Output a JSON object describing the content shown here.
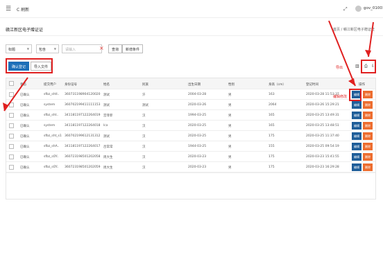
{
  "topbar": {
    "menu_icon": "menu-icon",
    "refresh_label": "C 刷新",
    "expand_icon": "expand-icon",
    "user_label": "gov_01001"
  },
  "page": {
    "title": "赣江新区电子赠证证",
    "breadcrumb": "首页 / 赣江新区电子赠证证"
  },
  "search": {
    "field_select": "标题",
    "op_select": "包含",
    "placeholder": "请输入",
    "query_label": "查询",
    "add_condition_label": "新增条件"
  },
  "actions": {
    "confirm_label": "确认登记",
    "import_label": "导入文件"
  },
  "hints": {
    "export_hint": "导出",
    "edit_hint": "编辑修改"
  },
  "table": {
    "columns": [
      "状态",
      "提交用户",
      "身份证号",
      "姓名",
      "民族",
      "出生日期",
      "性别",
      "身高（cm）",
      "登记时间",
      "操作"
    ],
    "edit_label": "编辑",
    "delete_label": "删除",
    "rows": [
      [
        "已确认",
        "sfbz_shtl..",
        "360731198904120020",
        "测试",
        "汗",
        "2004-03-28",
        "男",
        "163",
        "2020-03-28 11:53:37"
      ],
      [
        "已确认",
        "system",
        "360702199411111153",
        "测试",
        "测试",
        "2020-03-26",
        "男",
        "2064",
        "2020-03-26 15:29:21"
      ],
      [
        "已确认",
        "sfbz_sht..",
        "341181197122264019",
        "宫菲菲",
        "汉",
        "1994-03-25",
        "男",
        "165",
        "2020-03-25 13:49:31"
      ],
      [
        "已确认",
        "system",
        "341181197122264018",
        "lca",
        "汉",
        "2020-03-25",
        "男",
        "165",
        "2020-03-25 13:48:51"
      ],
      [
        "已确认",
        "sfbz_sht_s1",
        "360702199612131312",
        "测试",
        "汉",
        "2020-03-25",
        "男",
        "175",
        "2020-03-25 11:37:40"
      ],
      [
        "已确认",
        "sfbz_shA..",
        "341181197122264017",
        "吕常常",
        "汉",
        "1944-03-25",
        "男",
        "155",
        "2020-03-25 09:54:19"
      ],
      [
        "已确认",
        "sfbz_sOY..",
        "360723198501202058",
        "周大生",
        "汉",
        "2020-03-23",
        "男",
        "175",
        "2020-03-23 15:41:55"
      ],
      [
        "已确认",
        "sfbz_sOY..",
        "360723198501202059",
        "周大生",
        "汉",
        "2020-03-23",
        "男",
        "175",
        "2020-03-23 16:29:28"
      ]
    ]
  },
  "colors": {
    "accent_blue": "#1e6fb8",
    "delete_orange": "#ed6d2f",
    "annotation_red": "#e02020"
  }
}
